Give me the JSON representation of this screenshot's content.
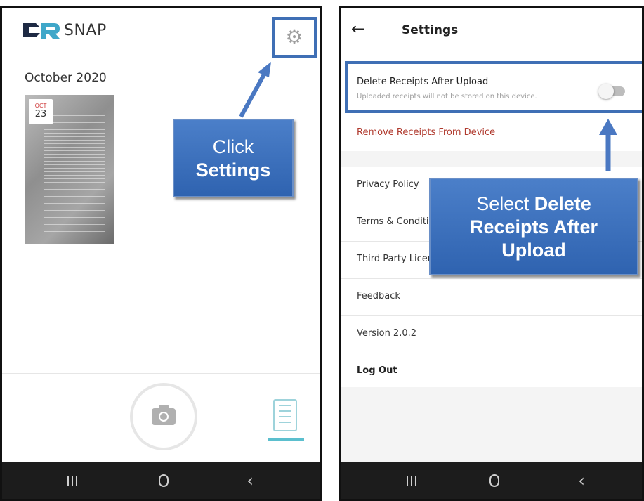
{
  "left_screen": {
    "app_name": "SNAP",
    "logo_mark": "CR",
    "month": "October 2020",
    "receipt": {
      "date_month": "OCT",
      "date_day": "23"
    },
    "callout": {
      "line1": "Click",
      "line2": "Settings"
    }
  },
  "right_screen": {
    "title": "Settings",
    "delete_receipts": {
      "title": "Delete Receipts After Upload",
      "subtitle": "Uploaded receipts will not be stored on this device.",
      "enabled": false
    },
    "remove_receipts": "Remove Receipts From Device",
    "rows": [
      "Privacy Policy",
      "Terms & Conditions",
      "Third Party Licenses",
      "Feedback",
      "Version 2.0.2",
      "Log Out"
    ],
    "callout": {
      "prefix": "Select",
      "bold1": "Delete",
      "bold2": "Receipts After",
      "bold3": "Upload"
    }
  },
  "colors": {
    "accent_blue": "#3f6fb5",
    "callout_blue": "#3a6fbf",
    "danger_red": "#b03a2e",
    "tab_teal": "#5bbfce"
  },
  "icons": [
    "gear-icon",
    "camera-icon",
    "receipts-icon",
    "back-arrow-icon",
    "recents-icon",
    "home-icon",
    "back-nav-icon"
  ]
}
